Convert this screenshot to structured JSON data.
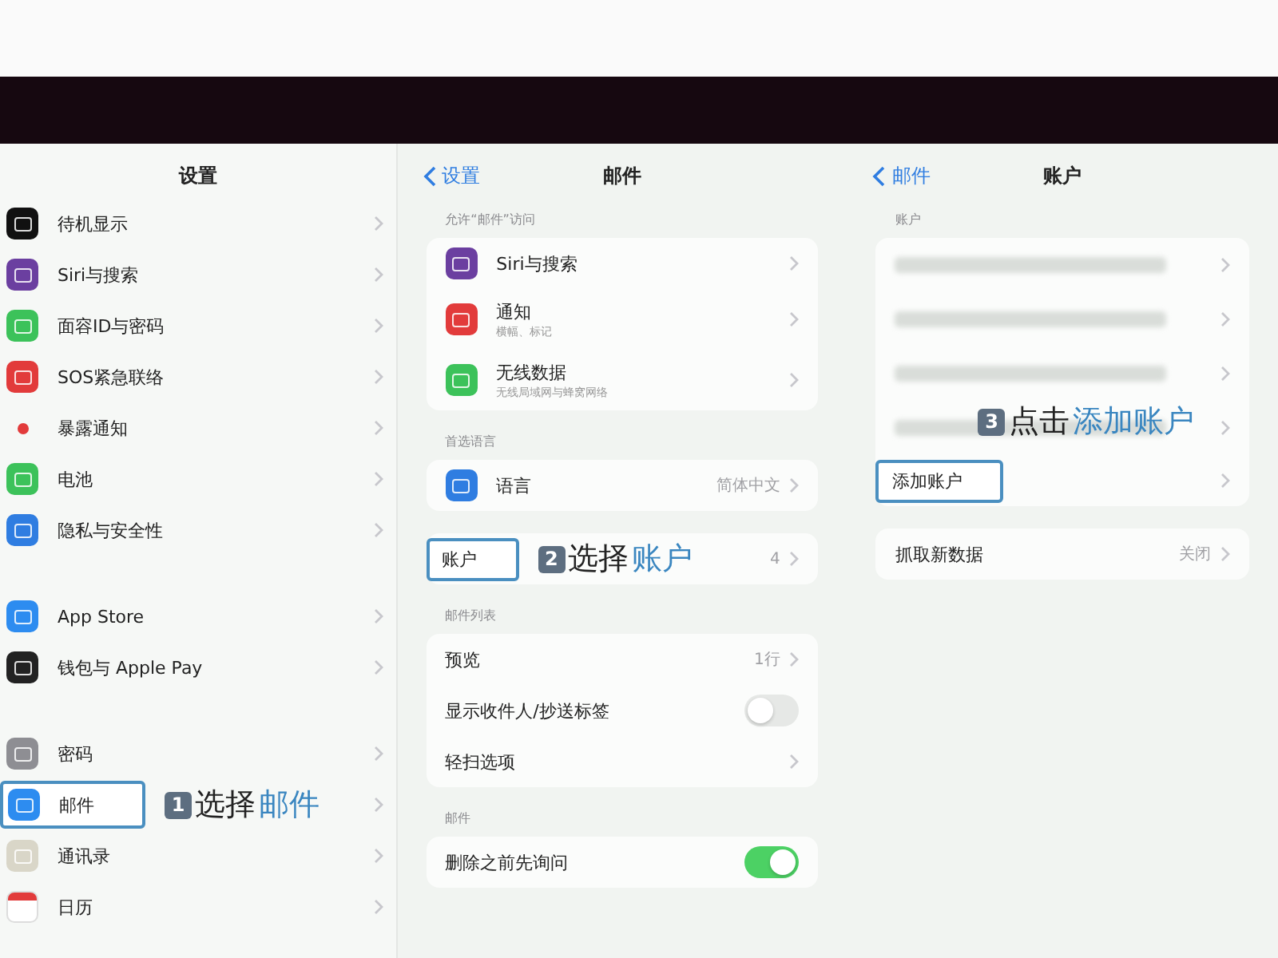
{
  "settings": {
    "title": "设置",
    "sections": [
      {
        "rows": [
          {
            "kind": "app",
            "label": "待机显示"
          },
          {
            "kind": "app",
            "label": "Siri与搜索"
          },
          {
            "kind": "app",
            "label": "面容ID与密码"
          },
          {
            "kind": "app",
            "label": "SOS紧急联络"
          },
          {
            "kind": "app",
            "label": "暴露通知"
          },
          {
            "kind": "app",
            "label": "电池"
          },
          {
            "kind": "app",
            "label": "隐私与安全性"
          }
        ]
      },
      {
        "rows": [
          {
            "kind": "app",
            "label": "App Store"
          },
          {
            "kind": "app",
            "label": "钱包与 Apple Pay"
          }
        ]
      },
      {
        "rows": [
          {
            "kind": "app",
            "label": "密码"
          },
          {
            "kind": "app",
            "label": "邮件",
            "highlighted": true,
            "annotation": {
              "number": "1",
              "verb": "选择",
              "target": "邮件"
            }
          },
          {
            "kind": "app",
            "label": "通讯录"
          },
          {
            "kind": "app",
            "label": "日历"
          }
        ]
      }
    ]
  },
  "mail": {
    "back": "设置",
    "title": "邮件",
    "sections": [
      {
        "header": "允许“邮件”访问",
        "rows": [
          {
            "kind": "app",
            "label": "Siri与搜索"
          },
          {
            "kind": "app",
            "label": "通知",
            "subtitle": "横幅、标记"
          },
          {
            "kind": "app",
            "label": "无线数据",
            "subtitle": "无线局域网与蜂窝网络"
          }
        ]
      },
      {
        "header": "首选语言",
        "rows": [
          {
            "kind": "app",
            "label": "语言",
            "value": "简体中文"
          }
        ]
      },
      {
        "rows": [
          {
            "kind": "nav",
            "label": "账户",
            "value": "4",
            "highlighted": true,
            "annotation": {
              "number": "2",
              "verb": "选择",
              "target": "账户"
            }
          }
        ]
      },
      {
        "header": "邮件列表",
        "rows": [
          {
            "kind": "nav",
            "label": "预览",
            "value": "1行"
          },
          {
            "kind": "toggle",
            "label": "显示收件人/抄送标签",
            "on": false
          },
          {
            "kind": "nav",
            "label": "轻扫选项"
          }
        ]
      },
      {
        "header": "邮件",
        "rows": [
          {
            "kind": "toggle",
            "label": "删除之前先询问",
            "on": true
          }
        ]
      }
    ]
  },
  "accounts": {
    "back": "邮件",
    "title": "账户",
    "sections": [
      {
        "header": "账户",
        "rows": [
          {
            "kind": "blurred"
          },
          {
            "kind": "blurred"
          },
          {
            "kind": "blurred"
          },
          {
            "kind": "blurred"
          },
          {
            "kind": "nav",
            "label": "添加账户",
            "highlighted": true,
            "annotation": {
              "number": "3",
              "verb": "点击",
              "target": "添加账户"
            }
          }
        ]
      },
      {
        "rows": [
          {
            "kind": "nav",
            "label": "抓取新数据",
            "value": "关闭"
          }
        ]
      }
    ]
  }
}
